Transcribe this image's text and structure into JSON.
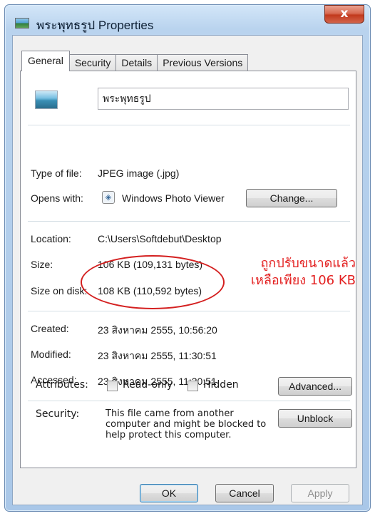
{
  "window": {
    "title": "พระพุทธรูป Properties",
    "close_glyph": "x"
  },
  "tabs": [
    {
      "label": "General"
    },
    {
      "label": "Security"
    },
    {
      "label": "Details"
    },
    {
      "label": "Previous Versions"
    }
  ],
  "file": {
    "name": "พระพุทธรูป"
  },
  "info": {
    "type_label": "Type of file:",
    "type_value": "JPEG image (.jpg)",
    "opens_label": "Opens with:",
    "opens_value": "Windows Photo Viewer",
    "change_button": "Change...",
    "location_label": "Location:",
    "location_value": "C:\\Users\\Softdebut\\Desktop",
    "size_label": "Size:",
    "size_value": "106 KB (109,131 bytes)",
    "size_on_disk_label": "Size on disk:",
    "size_on_disk_value": "108 KB (110,592 bytes)",
    "created_label": "Created:",
    "created_value": "23 สิงหาคม 2555, 10:56:20",
    "modified_label": "Modified:",
    "modified_value": "23 สิงหาคม 2555, 11:30:51",
    "accessed_label": "Accessed:",
    "accessed_value": "23 สิงหาคม 2555, 11:30:51"
  },
  "attributes": {
    "label": "Attributes:",
    "readonly": {
      "label": "Read-only",
      "checked": false
    },
    "hidden": {
      "label": "Hidden",
      "checked": false
    },
    "advanced_button": "Advanced..."
  },
  "security": {
    "label": "Security:",
    "text": "This file came from another computer and might be blocked to help protect this computer.",
    "unblock_button": "Unblock"
  },
  "annotation": {
    "line1": "ถูกปรับขนาดแล้ว",
    "line2": "เหลือเพียง 106 KB",
    "color": "#e32020"
  },
  "footer": {
    "ok": "OK",
    "cancel": "Cancel",
    "apply": "Apply"
  }
}
